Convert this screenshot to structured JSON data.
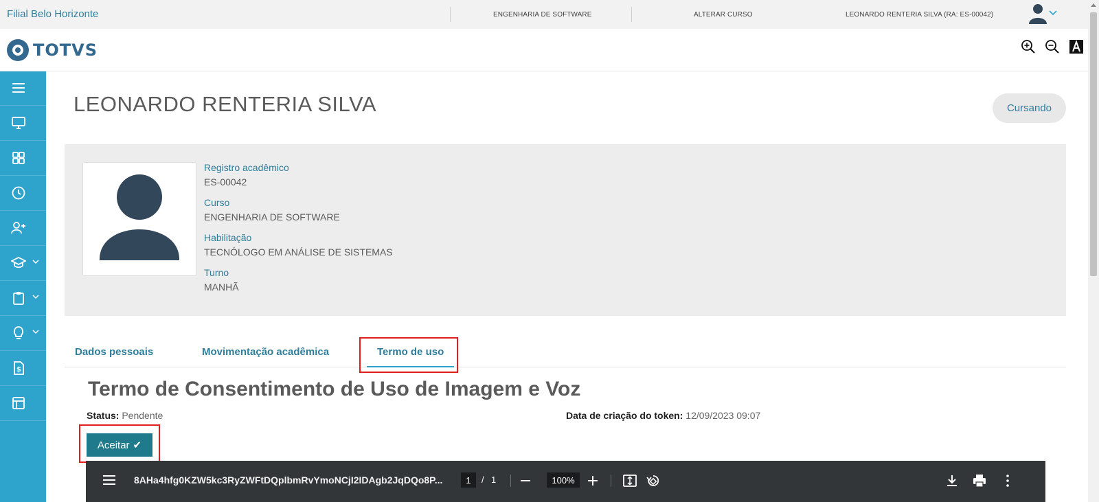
{
  "topbar": {
    "branch": "Filial Belo Horizonte",
    "course": "ENGENHARIA DE SOFTWARE",
    "change_course": "ALTERAR CURSO",
    "user": "LEONARDO RENTERIA SILVA (RA: ES-00042)"
  },
  "logo": {
    "text": "TOTVS"
  },
  "student": {
    "name": "LEONARDO RENTERIA SILVA",
    "status": "Cursando",
    "fields": [
      {
        "label": "Registro acadêmico",
        "value": "ES-00042"
      },
      {
        "label": "Curso",
        "value": "ENGENHARIA DE SOFTWARE"
      },
      {
        "label": "Habilitação",
        "value": "TECNÓLOGO EM ANÁLISE DE SISTEMAS"
      },
      {
        "label": "Turno",
        "value": "MANHÃ"
      }
    ]
  },
  "tabs": [
    {
      "label": "Dados pessoais"
    },
    {
      "label": "Movimentação acadêmica"
    },
    {
      "label": "Termo de uso",
      "active": true
    }
  ],
  "term": {
    "title": "Termo de Consentimento de Uso de Imagem e Voz",
    "status_label": "Status:",
    "status_value": "Pendente",
    "token_label": "Data de criação do token:",
    "token_value": "12/09/2023 09:07",
    "accept_label": "Aceitar"
  },
  "pdf": {
    "filename": "8AHa4hfg0KZW5kc3RyZWFtDQplbmRvYmoNCjI2IDAgb2JqDQo8P...",
    "page": "1",
    "page_sep": "/",
    "page_total": "1",
    "zoom": "100%"
  },
  "colors": {
    "sidebar": "#2ea3cc",
    "accent": "#2e7d9a",
    "button": "#1f7a8c",
    "highlight": "#e01e1e"
  }
}
